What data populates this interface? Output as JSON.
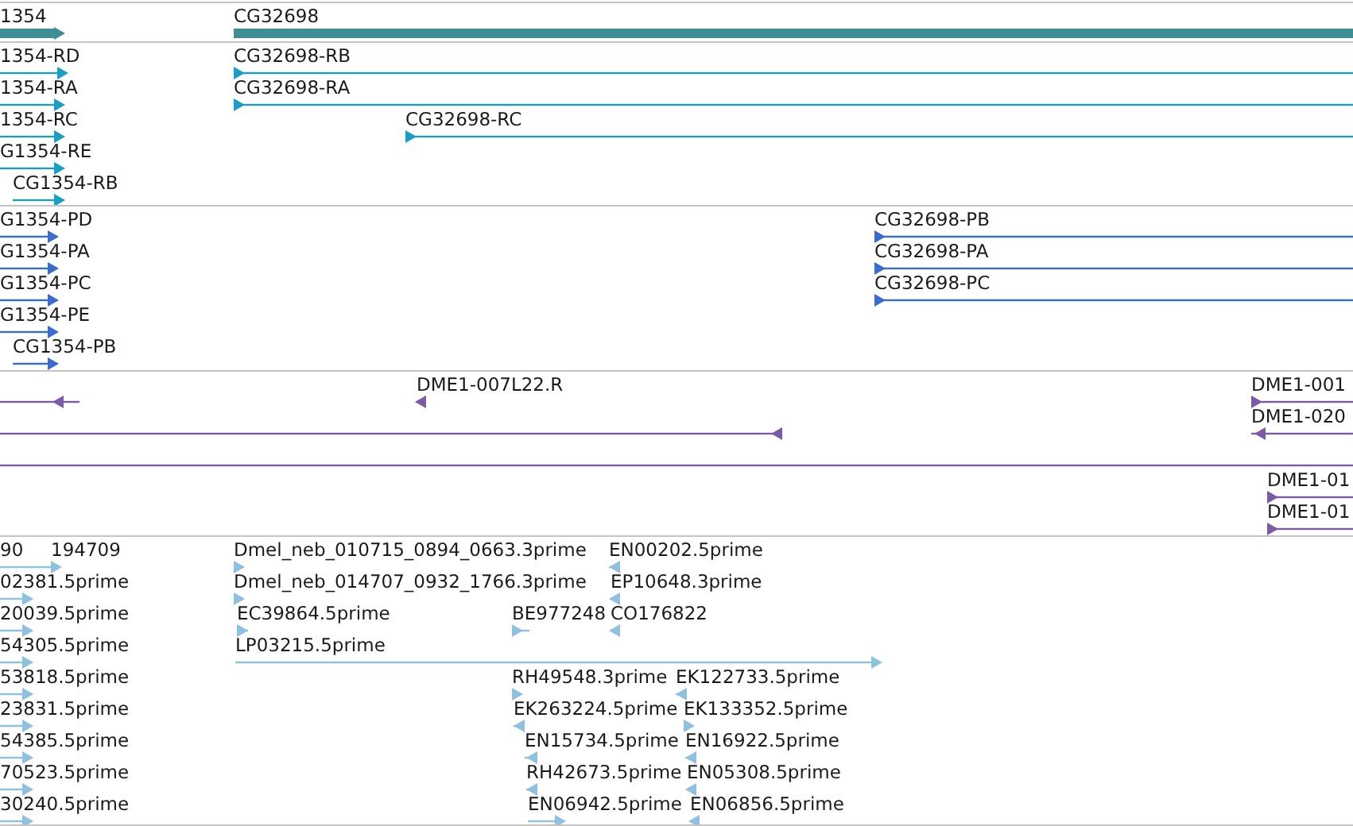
{
  "tracks": [
    {
      "kind": "bar",
      "color": "#3d8f93",
      "features": [
        {
          "label": "1354",
          "kind": "forward"
        },
        {
          "label": "CG32698",
          "kind": "forward"
        }
      ]
    },
    {
      "kind": "line",
      "color": "#1a9ec6",
      "features": [
        {
          "label": "1354-RD",
          "kind": "forward"
        },
        {
          "label": "1354-RA",
          "kind": "forward"
        },
        {
          "label": "1354-RC",
          "kind": "forward"
        },
        {
          "label": "G1354-RE",
          "kind": "forward"
        },
        {
          "label": "CG1354-RB",
          "kind": "forward"
        },
        {
          "label": "CG32698-RB",
          "kind": "forward"
        },
        {
          "label": "CG32698-RA",
          "kind": "forward"
        },
        {
          "label": "CG32698-RC",
          "kind": "forward"
        }
      ]
    },
    {
      "kind": "line",
      "color": "#3a6ccf",
      "features": [
        {
          "label": "G1354-PD",
          "kind": "forward"
        },
        {
          "label": "G1354-PA",
          "kind": "forward"
        },
        {
          "label": "G1354-PC",
          "kind": "forward"
        },
        {
          "label": "G1354-PE",
          "kind": "forward"
        },
        {
          "label": "CG1354-PB",
          "kind": "forward"
        },
        {
          "label": "CG32698-PB",
          "kind": "forward"
        },
        {
          "label": "CG32698-PA",
          "kind": "forward"
        },
        {
          "label": "CG32698-PC",
          "kind": "forward"
        }
      ]
    },
    {
      "kind": "line",
      "color": "#7b5aa8",
      "features": [
        {
          "kind": "reverse"
        },
        {
          "label": "DME1-007L22.R",
          "kind": "reverse"
        },
        {
          "kind": "reverse"
        },
        {
          "kind": "reverse"
        },
        {
          "label": "DME1-001",
          "kind": "forward"
        },
        {
          "label": "DME1-020",
          "kind": "reverse"
        },
        {
          "label": "DME1-01",
          "kind": "forward"
        },
        {
          "label": "DME1-01",
          "kind": "forward"
        }
      ]
    },
    {
      "kind": "line",
      "color": "#8ec0e0",
      "features": [
        {
          "label": "90"
        },
        {
          "label": "194709",
          "kind": "forward"
        },
        {
          "label": "02381.5prime",
          "kind": "forward"
        },
        {
          "label": "20039.5prime",
          "kind": "forward"
        },
        {
          "label": "54305.5prime",
          "kind": "forward"
        },
        {
          "label": "53818.5prime",
          "kind": "forward"
        },
        {
          "label": "23831.5prime",
          "kind": "forward"
        },
        {
          "label": "54385.5prime",
          "kind": "forward"
        },
        {
          "label": "70523.5prime",
          "kind": "forward"
        },
        {
          "label": "30240.5prime",
          "kind": "forward"
        },
        {
          "label": "Dmel_neb_010715_0894_0663.3prime",
          "kind": "forward"
        },
        {
          "label": "Dmel_neb_014707_0932_1766.3prime",
          "kind": "forward"
        },
        {
          "label": "EC39864.5prime",
          "kind": "forward"
        },
        {
          "label": "LP03215.5prime",
          "kind": "forward"
        },
        {
          "label": "BE977248",
          "kind": "forward"
        },
        {
          "label": "RH49548.3prime",
          "kind": "forward"
        },
        {
          "label": "EK263224.5prime",
          "kind": "reverse"
        },
        {
          "label": "EN15734.5prime",
          "kind": "reverse"
        },
        {
          "label": "RH42673.5prime",
          "kind": "reverse"
        },
        {
          "label": "EN06942.5prime",
          "kind": "forward"
        },
        {
          "label": "EN00202.5prime",
          "kind": "reverse"
        },
        {
          "label": "EP10648.3prime",
          "kind": "reverse"
        },
        {
          "label": "CO176822",
          "kind": "reverse"
        },
        {
          "label": "EK122733.5prime",
          "kind": "reverse"
        },
        {
          "label": "EK133352.5prime",
          "kind": "forward"
        },
        {
          "label": "EN16922.5prime",
          "kind": "reverse"
        },
        {
          "label": "EN05308.5prime",
          "kind": "reverse"
        },
        {
          "label": "EN06856.5prime",
          "kind": "reverse"
        }
      ]
    }
  ]
}
